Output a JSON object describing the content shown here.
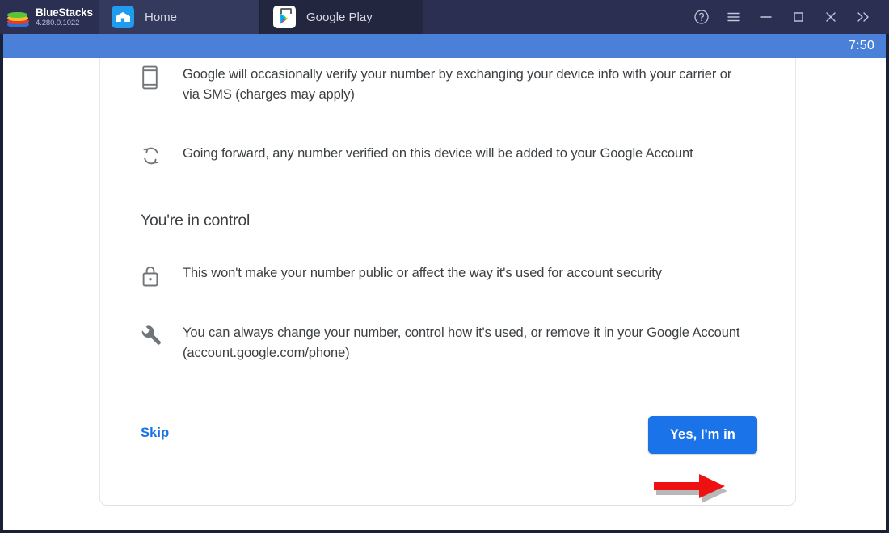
{
  "window": {
    "brand_name": "BlueStacks",
    "brand_version": "4.280.0.1022",
    "tabs": [
      {
        "label": "Home",
        "icon": "home-icon",
        "active": true
      },
      {
        "label": "Google Play",
        "icon": "google-play-icon",
        "active": false
      }
    ],
    "controls": [
      {
        "name": "help-icon",
        "glyph": "?"
      },
      {
        "name": "menu-icon",
        "glyph": "☰"
      },
      {
        "name": "minimize-icon",
        "glyph": "—"
      },
      {
        "name": "maximize-icon",
        "glyph": "□"
      },
      {
        "name": "close-icon",
        "glyph": "✕"
      },
      {
        "name": "expand-more-icon",
        "glyph": "»"
      }
    ]
  },
  "status_bar": {
    "time": "7:50"
  },
  "content": {
    "items": [
      {
        "icon": "phone-icon",
        "text": "Google will occasionally verify your number by exchanging your device info with your carrier or via SMS (charges may apply)"
      },
      {
        "icon": "sync-icon",
        "text": "Going forward, any number verified on this device will be added to your Google Account"
      }
    ],
    "section_title": "You're in control",
    "control_items": [
      {
        "icon": "lock-icon",
        "text": "This won't make your number public or affect the way it's used for account security"
      },
      {
        "icon": "wrench-icon",
        "text": "You can always change your number, control how it's used, or remove it in your Google Account (account.google.com/phone)"
      }
    ],
    "skip_label": "Skip",
    "confirm_label": "Yes, I'm in"
  },
  "annotation": {
    "arrow": "red-arrow-pointing-right-at-confirm-button"
  },
  "colors": {
    "titlebar": "#2b3052",
    "status_bar_blue": "#4a80d8",
    "accent_blue": "#1a73e8",
    "annotation_red": "#ee1111",
    "body_text": "#3c4043"
  }
}
